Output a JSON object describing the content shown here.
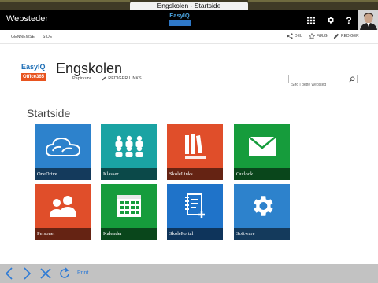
{
  "window": {
    "title": "Engskolen - Startside"
  },
  "suitebar": {
    "brand": "Websteder",
    "logo_text": "EasyIQ",
    "help_label": "?"
  },
  "ribbon": {
    "tabs": [
      "GENNEMSE",
      "SIDE"
    ],
    "actions": [
      {
        "label": "DEL",
        "icon": "share-icon"
      },
      {
        "label": "FØLG",
        "icon": "star-icon"
      },
      {
        "label": "REDIGER",
        "icon": "pencil-icon"
      }
    ]
  },
  "site": {
    "logo_line1": "EasyIQ",
    "logo_line2": "Office365",
    "title": "Engskolen",
    "sublink": "Papirkurv",
    "edit_links": "REDIGER LINKS"
  },
  "search": {
    "placeholder": "Søg i dette websted"
  },
  "page": {
    "heading": "Startside"
  },
  "tiles": [
    {
      "label": "OneDrive",
      "icon": "cloud-icon",
      "color": "#2d82cc"
    },
    {
      "label": "Klasser",
      "icon": "people-group-icon",
      "color": "#1aa3a3"
    },
    {
      "label": "SkoleLinks",
      "icon": "books-icon",
      "color": "#e04e2a"
    },
    {
      "label": "Outlook",
      "icon": "mail-icon",
      "color": "#169c3c"
    },
    {
      "label": "Personer",
      "icon": "persons-icon",
      "color": "#e04e2a"
    },
    {
      "label": "Kalender",
      "icon": "calendar-icon",
      "color": "#169c3c"
    },
    {
      "label": "SkolePortal",
      "icon": "notebook-icon",
      "color": "#1f73c9"
    },
    {
      "label": "Software",
      "icon": "gear-icon",
      "color": "#2d82cc"
    }
  ],
  "footer": {
    "print_label": "Print"
  }
}
